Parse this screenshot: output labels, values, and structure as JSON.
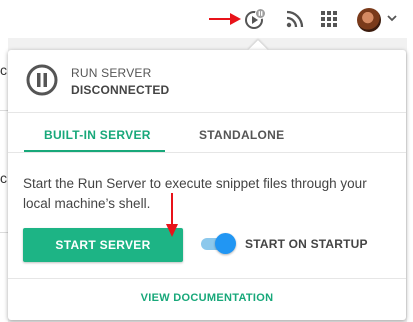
{
  "header": {
    "icons": [
      "run-server-paused-icon",
      "rss-icon",
      "apps-grid-icon",
      "avatar",
      "chevron-down-icon"
    ]
  },
  "background": {
    "fragment_top": "c",
    "fragment_bottom": "c"
  },
  "popover": {
    "status_title": "RUN SERVER",
    "status_value": "DISCONNECTED",
    "tabs": [
      {
        "label": "BUILT-IN SERVER",
        "active": true
      },
      {
        "label": "STANDALONE",
        "active": false
      }
    ],
    "description": "Start the Run Server to execute snippet files through your local machine’s shell.",
    "start_button_label": "START SERVER",
    "start_on_startup_label": "START ON STARTUP",
    "start_on_startup_enabled": true,
    "documentation_link": "VIEW DOCUMENTATION"
  },
  "colors": {
    "accent": "#1db485",
    "toggle": "#2196f3",
    "annotation": "#e8131a"
  }
}
